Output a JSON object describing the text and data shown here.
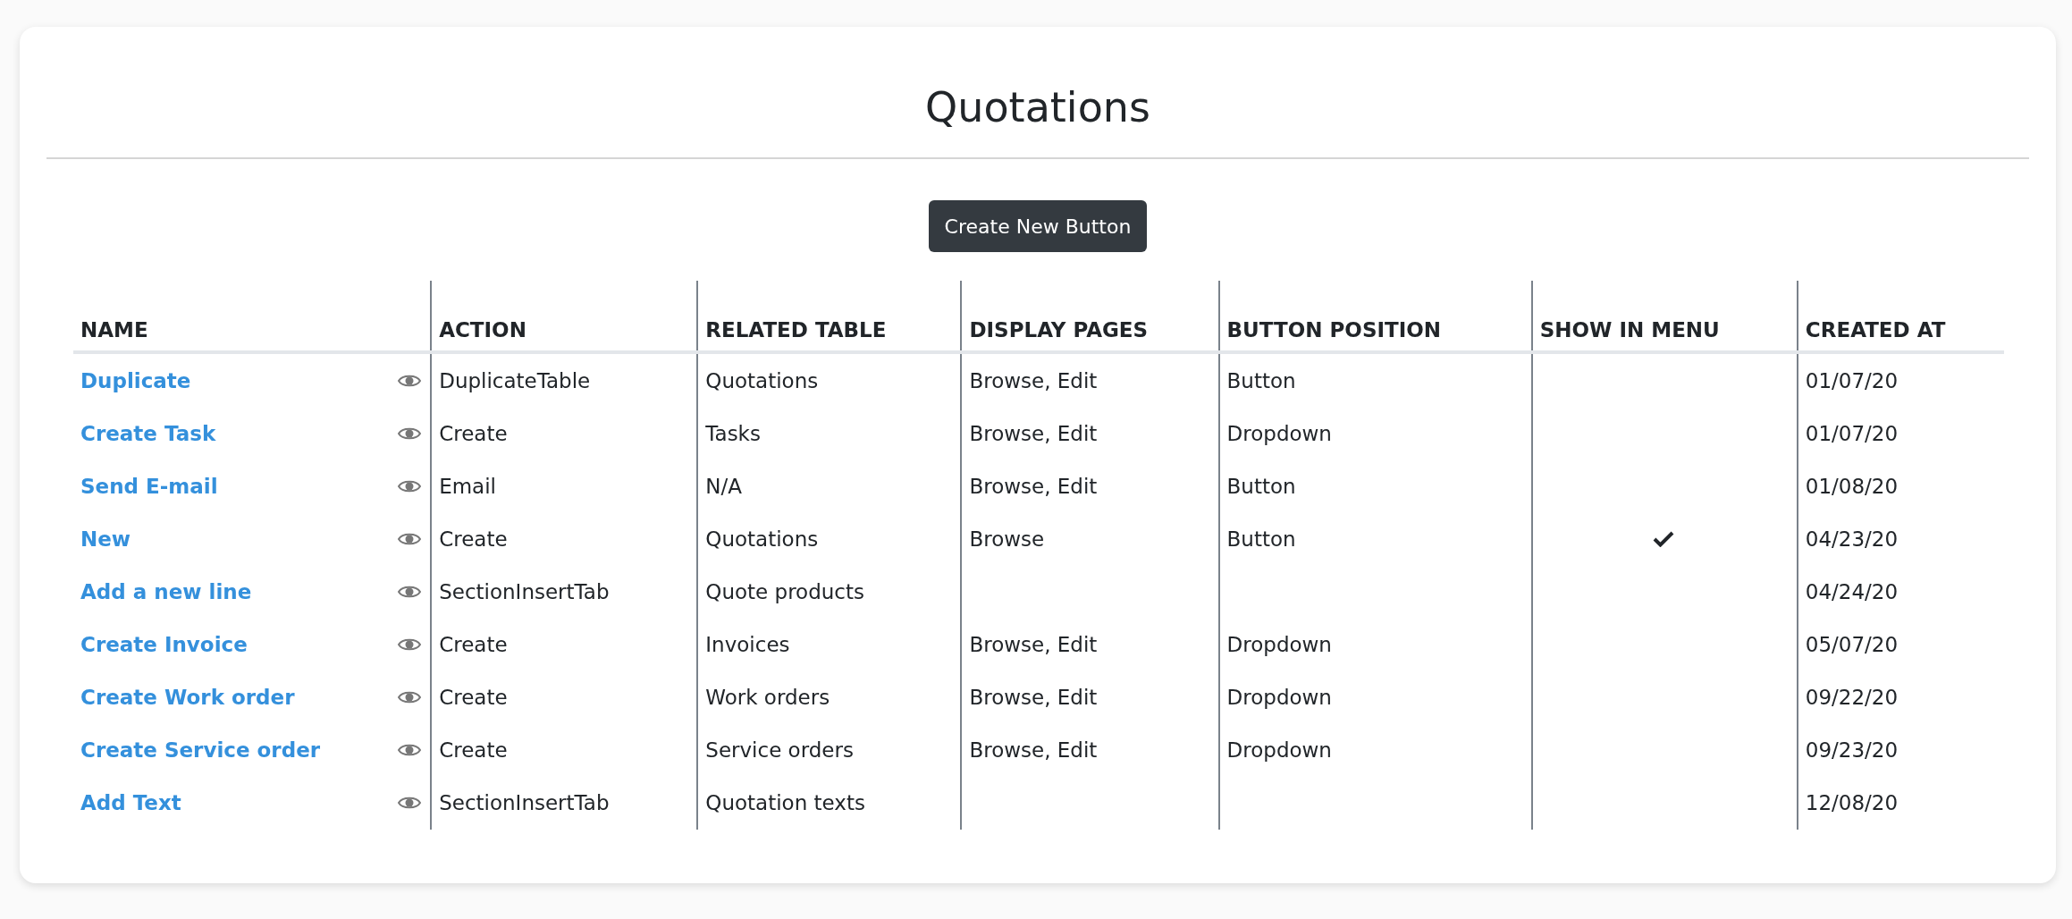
{
  "title": "Quotations",
  "create_button": "Create New Button",
  "table": {
    "columns": [
      "NAME",
      "ACTION",
      "RELATED TABLE",
      "DISPLAY PAGES",
      "BUTTON POSITION",
      "SHOW IN MENU",
      "CREATED AT"
    ],
    "rows": [
      {
        "name": "Duplicate",
        "action": "DuplicateTable",
        "related_table": "Quotations",
        "display_pages": "Browse, Edit",
        "button_position": "Button",
        "show_in_menu": false,
        "created_at": "01/07/20"
      },
      {
        "name": "Create Task",
        "action": "Create",
        "related_table": "Tasks",
        "display_pages": "Browse, Edit",
        "button_position": "Dropdown",
        "show_in_menu": false,
        "created_at": "01/07/20"
      },
      {
        "name": "Send E-mail",
        "action": "Email",
        "related_table": "N/A",
        "display_pages": "Browse, Edit",
        "button_position": "Button",
        "show_in_menu": false,
        "created_at": "01/08/20"
      },
      {
        "name": "New",
        "action": "Create",
        "related_table": "Quotations",
        "display_pages": "Browse",
        "button_position": "Button",
        "show_in_menu": true,
        "created_at": "04/23/20"
      },
      {
        "name": "Add a new line",
        "action": "SectionInsertTab",
        "related_table": "Quote products",
        "show_in_menu": false,
        "created_at": "04/24/20"
      },
      {
        "name": "Create Invoice",
        "action": "Create",
        "related_table": "Invoices",
        "display_pages": "Browse, Edit",
        "button_position": "Dropdown",
        "show_in_menu": false,
        "created_at": "05/07/20"
      },
      {
        "name": "Create Work order",
        "action": "Create",
        "related_table": "Work orders",
        "display_pages": "Browse, Edit",
        "button_position": "Dropdown",
        "show_in_menu": false,
        "created_at": "09/22/20"
      },
      {
        "name": "Create Service order",
        "action": "Create",
        "related_table": "Service orders",
        "display_pages": "Browse, Edit",
        "button_position": "Dropdown",
        "show_in_menu": false,
        "created_at": "09/23/20"
      },
      {
        "name": "Add Text",
        "action": "SectionInsertTab",
        "related_table": "Quotation texts",
        "show_in_menu": false,
        "created_at": "12/08/20"
      }
    ]
  }
}
